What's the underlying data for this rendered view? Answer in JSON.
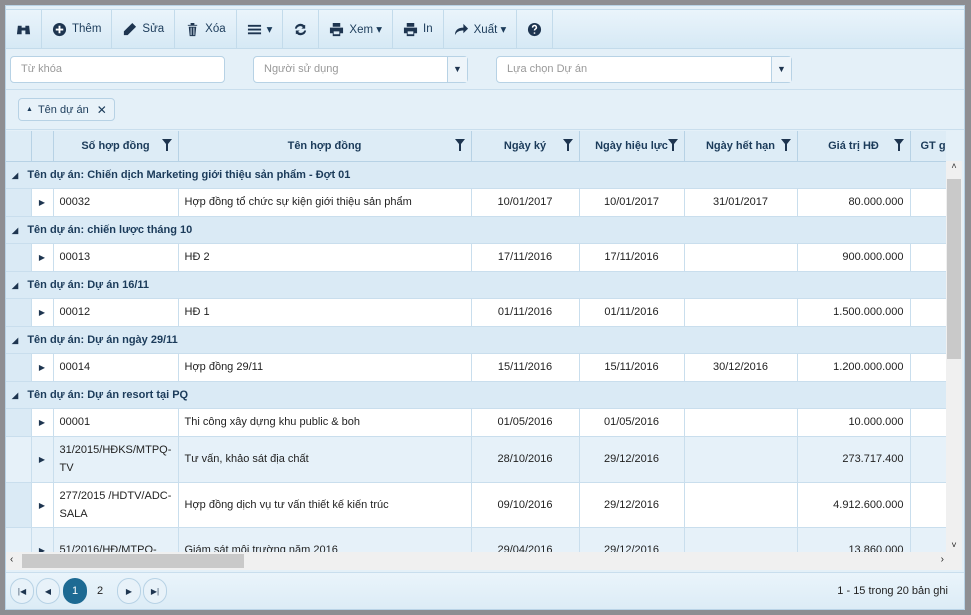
{
  "toolbar": {
    "items": [
      {
        "icon": "binoculars-icon",
        "label": ""
      },
      {
        "icon": "plus-circle-icon",
        "label": "Thêm"
      },
      {
        "icon": "pencil-icon",
        "label": "Sửa"
      },
      {
        "icon": "trash-icon",
        "label": "Xóa"
      },
      {
        "icon": "menu-icon",
        "label": "▾"
      },
      {
        "icon": "refresh-icon",
        "label": ""
      },
      {
        "icon": "print-icon",
        "label": "Xem ▾"
      },
      {
        "icon": "print-icon",
        "label": "In"
      },
      {
        "icon": "share-icon",
        "label": "Xuất ▾"
      },
      {
        "icon": "help-icon",
        "label": ""
      }
    ]
  },
  "filters": {
    "keyword_placeholder": "Từ khóa",
    "user_placeholder": "Người sử dụng",
    "project_placeholder": "Lựa chọn Dự án"
  },
  "group_chip": {
    "label": "Tên dự án"
  },
  "columns": [
    "Số hợp đồng",
    "Tên hợp đồng",
    "Ngày ký",
    "Ngày hiệu lực",
    "Ngày hết hạn",
    "Giá trị HĐ",
    "GT g"
  ],
  "groups": [
    {
      "title": "Tên dự án: Chiến dịch Marketing giới thiệu sản phẩm - Đợt 01",
      "rows": [
        [
          "00032",
          "Hợp đồng tổ chức sự kiện giới thiệu sản phẩm",
          "10/01/2017",
          "10/01/2017",
          "31/01/2017",
          "80.000.000"
        ]
      ]
    },
    {
      "title": "Tên dự án: chiến lược tháng 10",
      "rows": [
        [
          "00013",
          "HĐ 2",
          "17/11/2016",
          "17/11/2016",
          "",
          "900.000.000"
        ]
      ]
    },
    {
      "title": "Tên dự án: Dự án 16/11",
      "rows": [
        [
          "00012",
          "HĐ 1",
          "01/11/2016",
          "01/11/2016",
          "",
          "1.500.000.000"
        ]
      ]
    },
    {
      "title": "Tên dự án: Dự án ngày 29/11",
      "rows": [
        [
          "00014",
          "Hợp đồng 29/11",
          "15/11/2016",
          "15/11/2016",
          "30/12/2016",
          "1.200.000.000"
        ]
      ]
    },
    {
      "title": "Tên dự án: Dự án resort tại PQ",
      "rows": [
        [
          "00001",
          "Thi công xây dựng khu public & boh",
          "01/05/2016",
          "01/05/2016",
          "",
          "10.000.000"
        ],
        [
          "31/2015/HĐKS/MTPQ-TV",
          "Tư vấn, khảo sát địa chất",
          "28/10/2016",
          "29/12/2016",
          "",
          "273.717.400"
        ],
        [
          "277/2015 /HDTV/ADC-SALA",
          "Hợp đồng dịch vụ tư vấn thiết kế kiến trúc",
          "09/10/2016",
          "29/12/2016",
          "",
          "4.912.600.000"
        ],
        [
          "51/2016/HĐ/MTPQ-",
          "Giám sát môi trường năm 2016",
          "29/04/2016",
          "29/12/2016",
          "",
          "13.860.000"
        ]
      ]
    }
  ],
  "pager": {
    "pages": [
      "1",
      "2"
    ],
    "current": "1",
    "info": "1 - 15 trong 20 bản ghi"
  }
}
